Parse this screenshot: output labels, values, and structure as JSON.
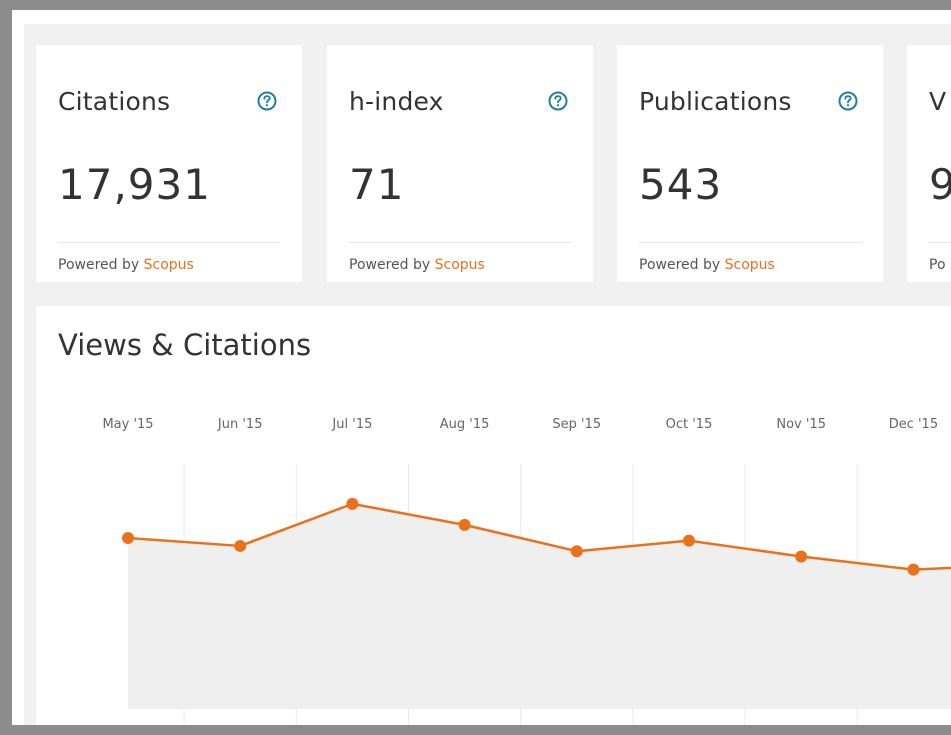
{
  "metrics": [
    {
      "title": "Citations",
      "value": "17,931",
      "powered_prefix": "Powered by",
      "powered_link": "Scopus"
    },
    {
      "title": "h-index",
      "value": "71",
      "powered_prefix": "Powered by",
      "powered_link": "Scopus"
    },
    {
      "title": "Publications",
      "value": "543",
      "powered_prefix": "Powered by",
      "powered_link": "Scopus"
    },
    {
      "title": "V",
      "value": "9",
      "powered_prefix": "Po",
      "powered_link": ""
    }
  ],
  "colors": {
    "accent_orange": "#e9711c",
    "help_icon_teal": "#1f7ea6",
    "area_fill": "#efefef",
    "gridline": "#e9e9e9"
  },
  "icons": {
    "help": "question-circle-icon"
  },
  "chart": {
    "title": "Views & Citations"
  },
  "chart_data": {
    "type": "area",
    "title": "Views & Citations",
    "x": [
      "May '15",
      "Jun '15",
      "Jul '15",
      "Aug '15",
      "Sep '15",
      "Oct '15",
      "Nov '15",
      "Dec '15"
    ],
    "series": [
      {
        "values": [
          65,
          62,
          78,
          70,
          60,
          64,
          58,
          53,
          55
        ]
      }
    ],
    "ylim": [
      0,
      100
    ],
    "grid": "vertical",
    "xlabel": "",
    "ylabel": ""
  }
}
